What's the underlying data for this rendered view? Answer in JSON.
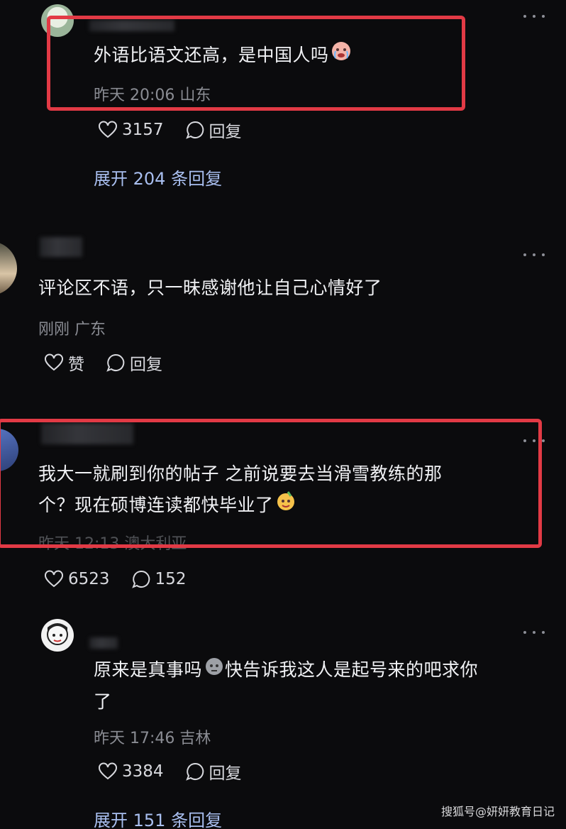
{
  "comments": [
    {
      "text": "外语比语文还高，是中国人吗",
      "time": "昨天 20:06 山东",
      "likes": "3157",
      "reply_label": "回复",
      "expand": "展开 204 条回复"
    },
    {
      "text": "评论区不语，只一昧感谢他让自己心情好了",
      "time": "刚刚 广东",
      "likes": "赞",
      "reply_label": "回复"
    },
    {
      "text_line1": "我大一就刷到你的帖子 之前说要去当滑雪教练的那",
      "text_line2": "个？现在硕博连读都快毕业了",
      "time": "昨天 12:13 澳大利亚",
      "likes": "6523",
      "replies": "152"
    },
    {
      "text_line1": "原来是真事吗",
      "text_line1b": "快告诉我这人是起号来的吧求你",
      "text_line2": "了",
      "time": "昨天 17:46 吉林",
      "likes": "3384",
      "reply_label": "回复",
      "expand": "展开 151 条回复"
    }
  ],
  "watermark": "搜狐号@妍妍教育日记",
  "colors": {
    "background": "#0b0b0d",
    "highlight_box": "#e23a45",
    "link": "#a9bff0",
    "meta": "#8a8c93"
  }
}
